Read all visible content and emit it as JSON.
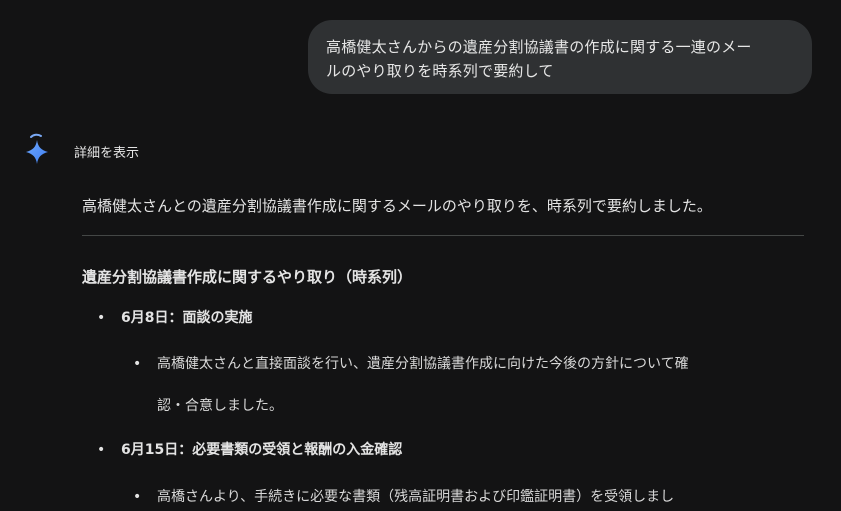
{
  "user_message": {
    "line1": "高橋健太さんからの遺産分割協議書の作成に関する一連のメー",
    "line2": "ルのやり取りを時系列で要約して"
  },
  "response": {
    "details_toggle": "詳細を表示",
    "intro": "高橋健太さんとの遺産分割協議書作成に関するメールのやり取りを、時系列で要約しました。",
    "section_heading": "遺産分割協議書作成に関するやり取り（時系列）",
    "events": [
      {
        "title": "6月8日：面談の実施",
        "detail_line1": "高橋健太さんと直接面談を行い、遺産分割協議書作成に向けた今後の方針について確",
        "detail_line2": "認・合意しました。"
      },
      {
        "title": "6月15日：必要書類の受領と報酬の入金確認",
        "detail_line1": "高橋さんより、手続きに必要な書類（残高証明書および印鑑証明書）を受領しまし"
      }
    ]
  },
  "icons": {
    "assistant": "gemini-sparkle-icon"
  },
  "colors": {
    "background": "#131314",
    "user_bubble": "#2f3133",
    "divider": "#444746",
    "sparkle_accent": "#4c8df6"
  }
}
